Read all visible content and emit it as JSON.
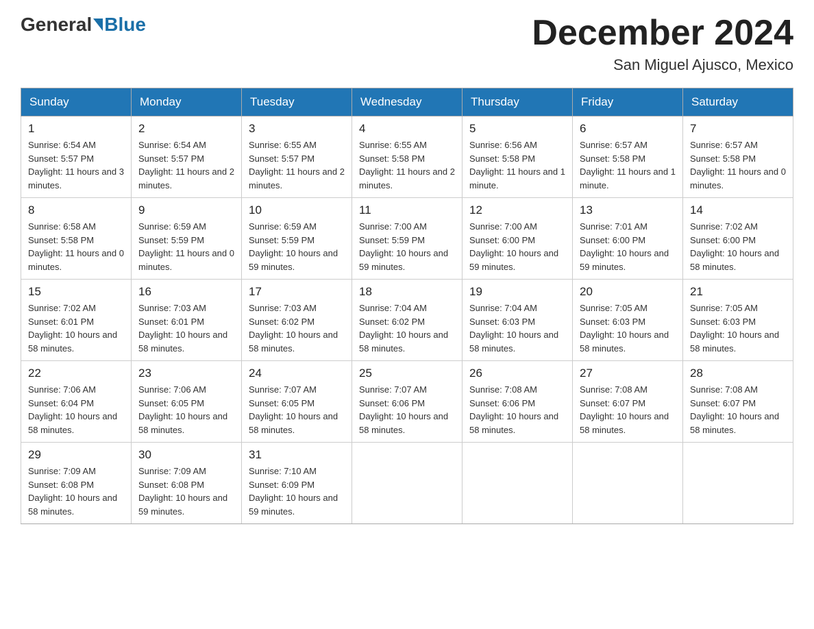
{
  "header": {
    "logo_general": "General",
    "logo_blue": "Blue",
    "month_title": "December 2024",
    "location": "San Miguel Ajusco, Mexico"
  },
  "days_of_week": [
    "Sunday",
    "Monday",
    "Tuesday",
    "Wednesday",
    "Thursday",
    "Friday",
    "Saturday"
  ],
  "weeks": [
    [
      {
        "day": "1",
        "sunrise": "6:54 AM",
        "sunset": "5:57 PM",
        "daylight": "11 hours and 3 minutes."
      },
      {
        "day": "2",
        "sunrise": "6:54 AM",
        "sunset": "5:57 PM",
        "daylight": "11 hours and 2 minutes."
      },
      {
        "day": "3",
        "sunrise": "6:55 AM",
        "sunset": "5:57 PM",
        "daylight": "11 hours and 2 minutes."
      },
      {
        "day": "4",
        "sunrise": "6:55 AM",
        "sunset": "5:58 PM",
        "daylight": "11 hours and 2 minutes."
      },
      {
        "day": "5",
        "sunrise": "6:56 AM",
        "sunset": "5:58 PM",
        "daylight": "11 hours and 1 minute."
      },
      {
        "day": "6",
        "sunrise": "6:57 AM",
        "sunset": "5:58 PM",
        "daylight": "11 hours and 1 minute."
      },
      {
        "day": "7",
        "sunrise": "6:57 AM",
        "sunset": "5:58 PM",
        "daylight": "11 hours and 0 minutes."
      }
    ],
    [
      {
        "day": "8",
        "sunrise": "6:58 AM",
        "sunset": "5:58 PM",
        "daylight": "11 hours and 0 minutes."
      },
      {
        "day": "9",
        "sunrise": "6:59 AM",
        "sunset": "5:59 PM",
        "daylight": "11 hours and 0 minutes."
      },
      {
        "day": "10",
        "sunrise": "6:59 AM",
        "sunset": "5:59 PM",
        "daylight": "10 hours and 59 minutes."
      },
      {
        "day": "11",
        "sunrise": "7:00 AM",
        "sunset": "5:59 PM",
        "daylight": "10 hours and 59 minutes."
      },
      {
        "day": "12",
        "sunrise": "7:00 AM",
        "sunset": "6:00 PM",
        "daylight": "10 hours and 59 minutes."
      },
      {
        "day": "13",
        "sunrise": "7:01 AM",
        "sunset": "6:00 PM",
        "daylight": "10 hours and 59 minutes."
      },
      {
        "day": "14",
        "sunrise": "7:02 AM",
        "sunset": "6:00 PM",
        "daylight": "10 hours and 58 minutes."
      }
    ],
    [
      {
        "day": "15",
        "sunrise": "7:02 AM",
        "sunset": "6:01 PM",
        "daylight": "10 hours and 58 minutes."
      },
      {
        "day": "16",
        "sunrise": "7:03 AM",
        "sunset": "6:01 PM",
        "daylight": "10 hours and 58 minutes."
      },
      {
        "day": "17",
        "sunrise": "7:03 AM",
        "sunset": "6:02 PM",
        "daylight": "10 hours and 58 minutes."
      },
      {
        "day": "18",
        "sunrise": "7:04 AM",
        "sunset": "6:02 PM",
        "daylight": "10 hours and 58 minutes."
      },
      {
        "day": "19",
        "sunrise": "7:04 AM",
        "sunset": "6:03 PM",
        "daylight": "10 hours and 58 minutes."
      },
      {
        "day": "20",
        "sunrise": "7:05 AM",
        "sunset": "6:03 PM",
        "daylight": "10 hours and 58 minutes."
      },
      {
        "day": "21",
        "sunrise": "7:05 AM",
        "sunset": "6:03 PM",
        "daylight": "10 hours and 58 minutes."
      }
    ],
    [
      {
        "day": "22",
        "sunrise": "7:06 AM",
        "sunset": "6:04 PM",
        "daylight": "10 hours and 58 minutes."
      },
      {
        "day": "23",
        "sunrise": "7:06 AM",
        "sunset": "6:05 PM",
        "daylight": "10 hours and 58 minutes."
      },
      {
        "day": "24",
        "sunrise": "7:07 AM",
        "sunset": "6:05 PM",
        "daylight": "10 hours and 58 minutes."
      },
      {
        "day": "25",
        "sunrise": "7:07 AM",
        "sunset": "6:06 PM",
        "daylight": "10 hours and 58 minutes."
      },
      {
        "day": "26",
        "sunrise": "7:08 AM",
        "sunset": "6:06 PM",
        "daylight": "10 hours and 58 minutes."
      },
      {
        "day": "27",
        "sunrise": "7:08 AM",
        "sunset": "6:07 PM",
        "daylight": "10 hours and 58 minutes."
      },
      {
        "day": "28",
        "sunrise": "7:08 AM",
        "sunset": "6:07 PM",
        "daylight": "10 hours and 58 minutes."
      }
    ],
    [
      {
        "day": "29",
        "sunrise": "7:09 AM",
        "sunset": "6:08 PM",
        "daylight": "10 hours and 58 minutes."
      },
      {
        "day": "30",
        "sunrise": "7:09 AM",
        "sunset": "6:08 PM",
        "daylight": "10 hours and 59 minutes."
      },
      {
        "day": "31",
        "sunrise": "7:10 AM",
        "sunset": "6:09 PM",
        "daylight": "10 hours and 59 minutes."
      },
      null,
      null,
      null,
      null
    ]
  ]
}
